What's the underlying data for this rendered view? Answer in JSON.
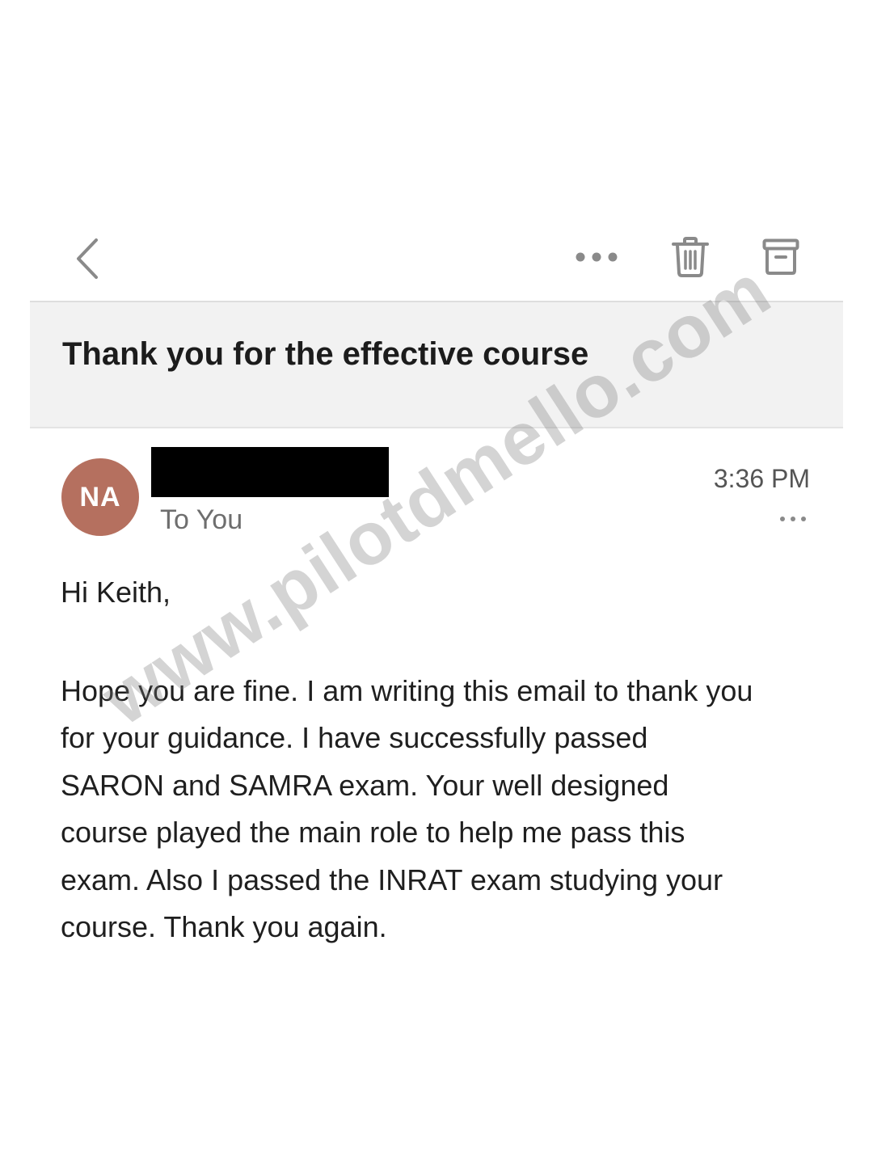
{
  "toolbar": {
    "back_icon": "chevron-left-icon",
    "more_icon": "ellipsis-icon",
    "trash_icon": "trash-icon",
    "archive_icon": "archive-icon"
  },
  "email": {
    "subject": "Thank you for the effective course",
    "sender": {
      "initials": "NA",
      "avatar_color": "#b5705f"
    },
    "recipient": "To You",
    "time": "3:36 PM",
    "greeting": "Hi Keith,",
    "body_lines": [
      "Hope you are fine. I am writing this email to thank you",
      "for your guidance. I have successfully passed",
      "SARON and SAMRA exam. Your well designed",
      "course played the main role to help me pass this",
      "exam. Also I passed the INRAT exam studying your",
      "course. Thank you again."
    ]
  },
  "watermark": "www.pilotdmello.com"
}
